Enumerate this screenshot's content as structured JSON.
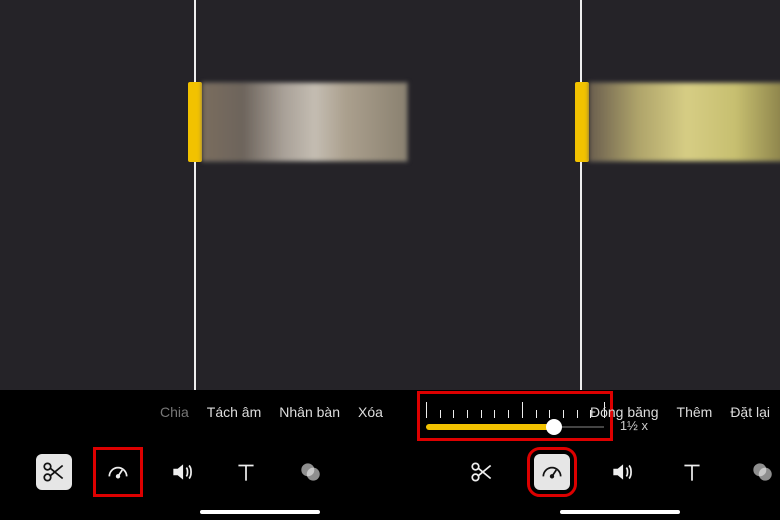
{
  "actions": {
    "split": "Chia",
    "detach_audio": "Tách âm",
    "duplicate": "Nhân bàn",
    "delete": "Xóa",
    "freeze": "Đóng băng",
    "add": "Thêm",
    "reset": "Đặt lại"
  },
  "speed": {
    "value_label": "1½ x",
    "fill_percent": 72,
    "ticks": 14
  },
  "icons": {
    "cut": "scissors-icon",
    "speed": "speedometer-icon",
    "volume": "volume-icon",
    "text": "text-icon",
    "filters": "filters-icon"
  }
}
